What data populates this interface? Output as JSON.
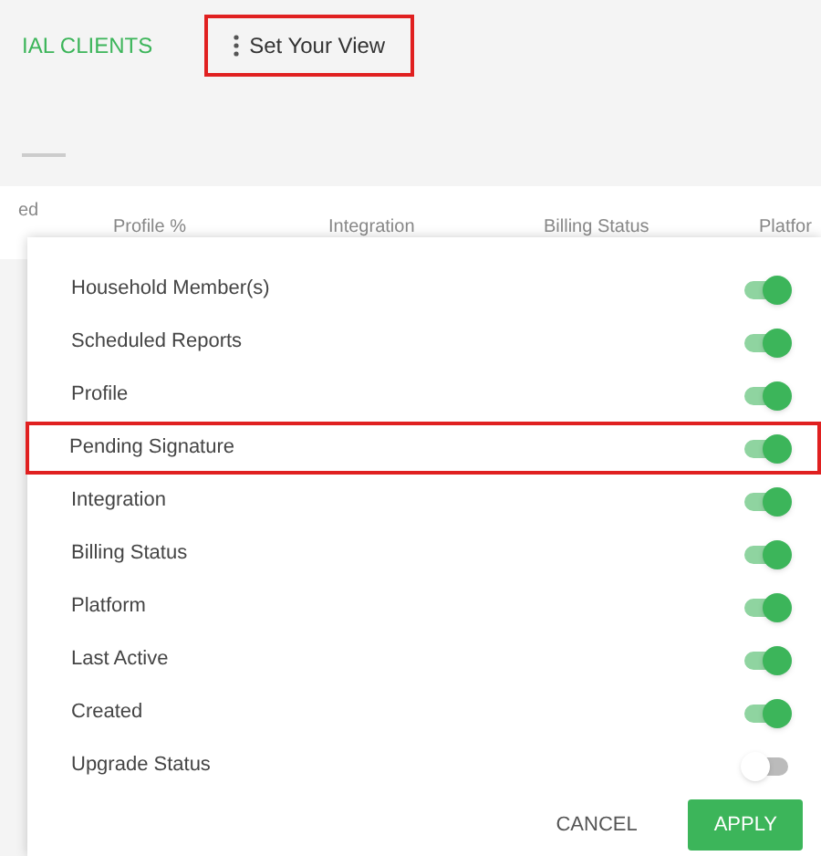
{
  "tabs": [
    {
      "label": "IAL CLIENTS",
      "selected": true
    }
  ],
  "view_button": {
    "label": "Set Your View",
    "outlined": true
  },
  "table": {
    "columns": [
      "ed",
      "Profile %",
      "Integration",
      "Billing Status",
      "Platfor"
    ]
  },
  "view_panel": {
    "options": [
      {
        "label": "Household Member(s)",
        "on": true,
        "outlined": false
      },
      {
        "label": "Scheduled Reports",
        "on": true,
        "outlined": false
      },
      {
        "label": "Profile",
        "on": true,
        "outlined": false
      },
      {
        "label": "Pending Signature",
        "on": true,
        "outlined": true
      },
      {
        "label": "Integration",
        "on": true,
        "outlined": false
      },
      {
        "label": "Billing Status",
        "on": true,
        "outlined": false
      },
      {
        "label": "Platform",
        "on": true,
        "outlined": false
      },
      {
        "label": "Last Active",
        "on": true,
        "outlined": false
      },
      {
        "label": "Created",
        "on": true,
        "outlined": false
      },
      {
        "label": "Upgrade Status",
        "on": false,
        "outlined": false
      }
    ],
    "buttons": [
      "CANCEL",
      "APPLY"
    ]
  }
}
